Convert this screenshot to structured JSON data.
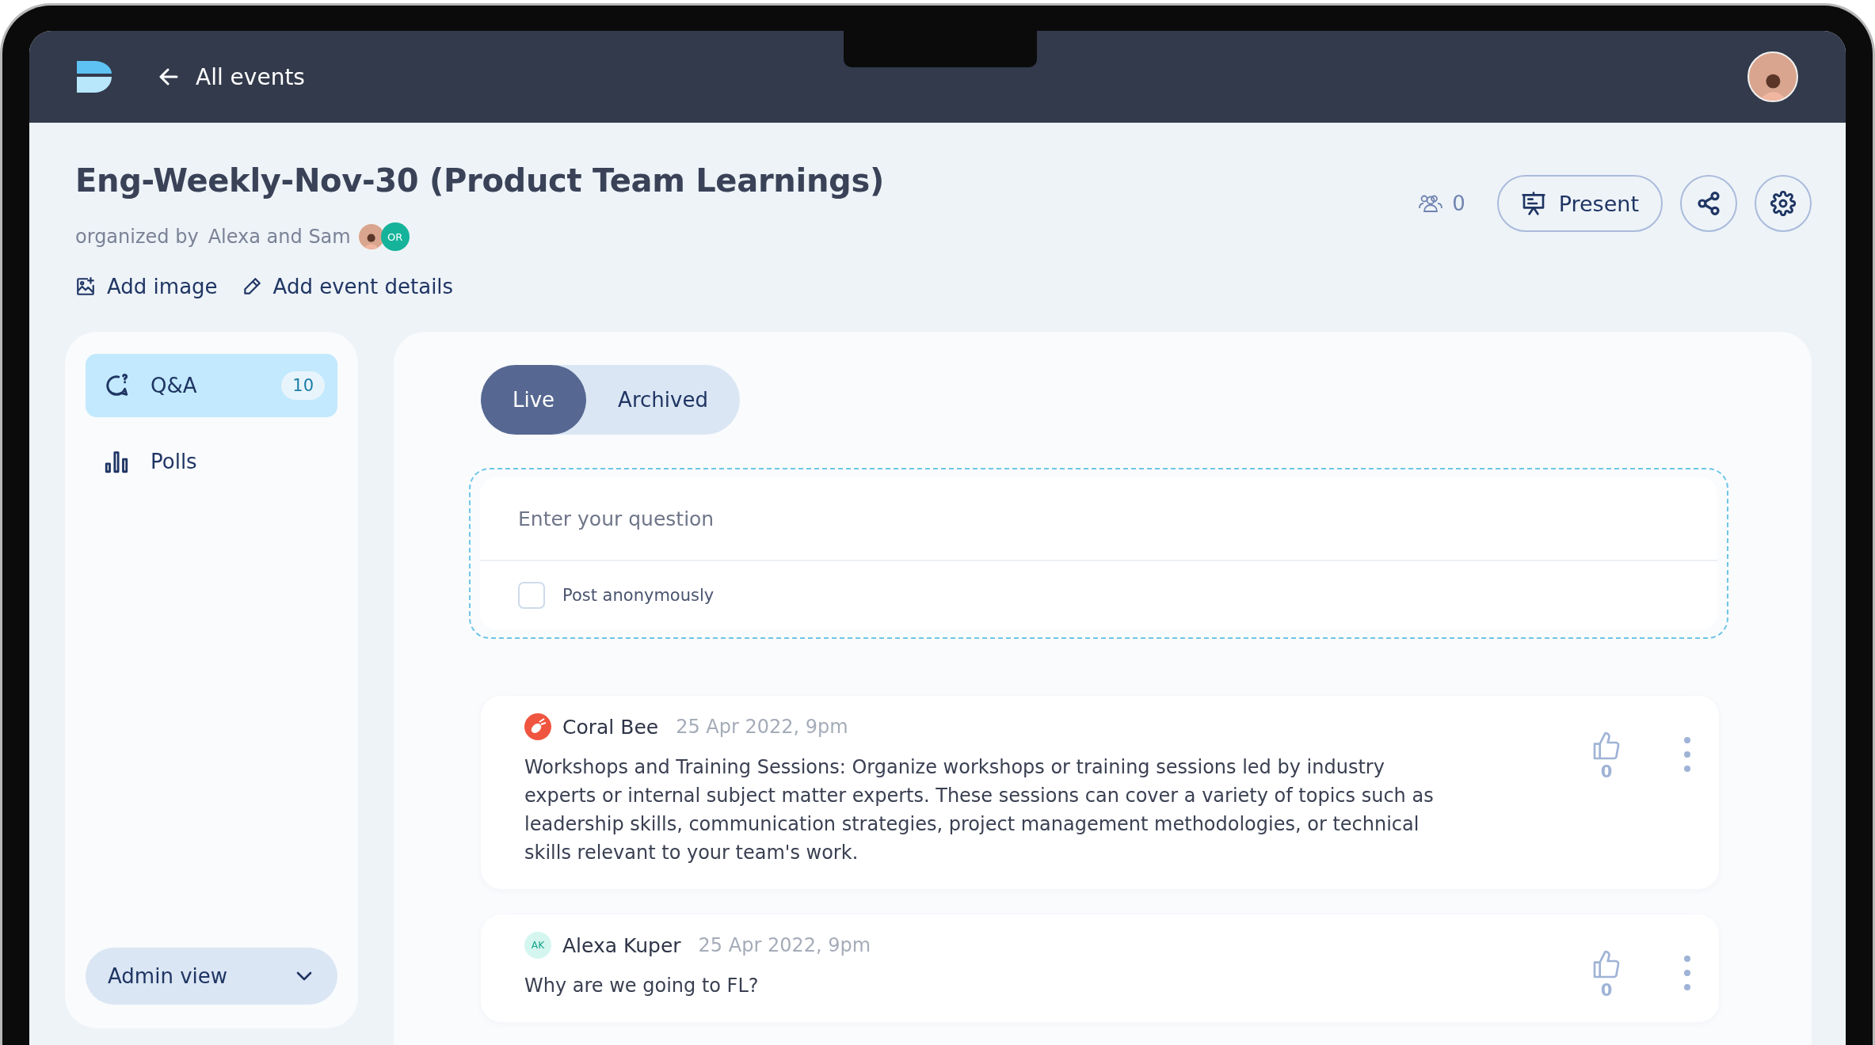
{
  "header": {
    "back_label": "All events"
  },
  "event": {
    "title": "Eng-Weekly-Nov-30 (Product Team Learnings)",
    "organized_prefix": "organized by",
    "organizers": "Alexa and Sam",
    "co_organizer_initials": "OR",
    "participants_count": "0",
    "present_label": "Present",
    "actions": [
      {
        "kind": "image",
        "label": "Add image"
      },
      {
        "kind": "edit",
        "label": "Add event details"
      }
    ]
  },
  "sidebar": {
    "items": [
      {
        "kind": "qa",
        "label": "Q&A",
        "count": "10",
        "selected": true
      },
      {
        "kind": "polls",
        "label": "Polls",
        "selected": false
      }
    ],
    "view_selector": "Admin view"
  },
  "tabs": [
    {
      "label": "Live",
      "selected": true
    },
    {
      "label": "Archived",
      "selected": false
    }
  ],
  "question_input": {
    "placeholder": "Enter your question",
    "anonymous_label": "Post anonymously",
    "anonymous_checked": false
  },
  "questions": [
    {
      "kind": "emblem",
      "author": "Coral Bee",
      "time": "25 Apr 2022, 9pm",
      "text": "Workshops and Training Sessions: Organize workshops or training sessions led by industry experts or internal subject matter experts. These sessions can cover a variety of topics such as leadership skills, communication strategies, project management methodologies, or technical skills relevant to your team's work.",
      "votes": "0"
    },
    {
      "kind": "initials",
      "initials": "AK",
      "author": "Alexa Kuper",
      "time": "25 Apr 2022, 9pm",
      "text": "Why are we going to FL?",
      "votes": "0"
    }
  ]
}
